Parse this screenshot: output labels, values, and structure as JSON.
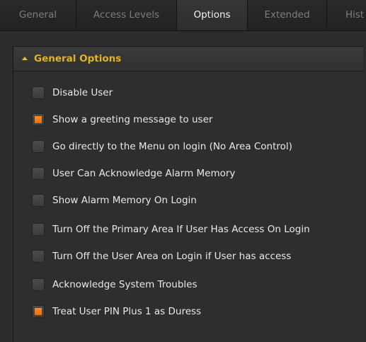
{
  "tabs": [
    {
      "label": "General",
      "active": false
    },
    {
      "label": "Access Levels",
      "active": false
    },
    {
      "label": "Options",
      "active": true
    },
    {
      "label": "Extended",
      "active": false
    },
    {
      "label": "Hist",
      "active": false
    }
  ],
  "panel": {
    "title": "General Options"
  },
  "options": [
    {
      "label": "Disable User",
      "checked": false
    },
    {
      "label": "Show a greeting message to user",
      "checked": true
    },
    {
      "label": "Go directly to the Menu on login (No Area Control)",
      "checked": false
    },
    {
      "label": "User Can Acknowledge Alarm Memory",
      "checked": false
    },
    {
      "label": "Show Alarm Memory On Login",
      "checked": false
    },
    {
      "label": "Turn Off the Primary Area If User Has Access On Login",
      "checked": false
    },
    {
      "label": "Turn Off the User Area on Login if User has access",
      "checked": false
    },
    {
      "label": "Acknowledge System Troubles",
      "checked": false
    },
    {
      "label": "Treat User PIN  Plus 1 as Duress",
      "checked": true
    }
  ],
  "colors": {
    "accent": "#e0b32a",
    "checked": "#f07a18"
  }
}
